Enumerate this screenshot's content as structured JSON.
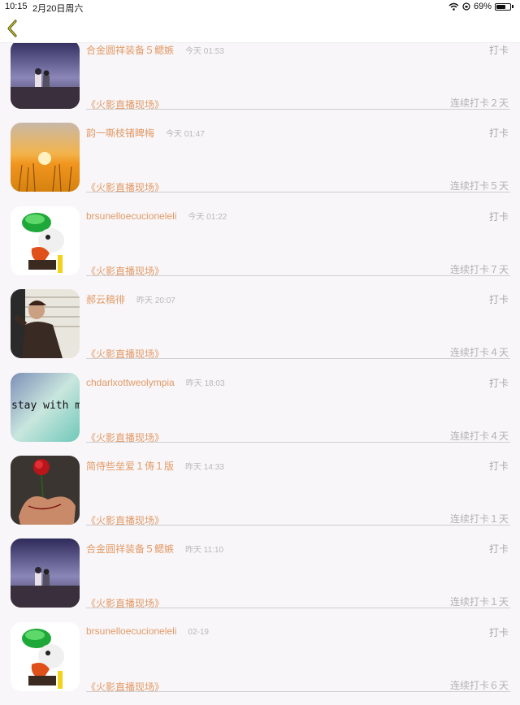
{
  "status_bar": {
    "time": "10:15",
    "date": "2月20日周六",
    "battery": "69%",
    "battery_level": 0.69
  },
  "nav": {
    "back_icon": "chevron-left-icon",
    "accent_color": "#a3a31a"
  },
  "colors": {
    "name": "#e29a67",
    "muted": "#b2b2b2",
    "background": "#f8f6f8"
  },
  "items": [
    {
      "avatar": "night-sky",
      "name": "合金圆祥装备５鳃嫉",
      "time": "今天 01:53",
      "action": "打卡",
      "group": "《火影直播现场》",
      "streak": "连续打卡２天"
    },
    {
      "avatar": "sunset-field",
      "name": "韵一嘶枝锗睥梅",
      "time": "今天 01:47",
      "action": "打卡",
      "group": "《火影直播现场》",
      "streak": "连续打卡５天"
    },
    {
      "avatar": "joker-figure",
      "name": "brsunelloecucioneleli",
      "time": "今天 01:22",
      "action": "打卡",
      "group": "《火影直播现场》",
      "streak": "连续打卡７天"
    },
    {
      "avatar": "man-portrait",
      "name": "郝云稿徘",
      "time": "昨天 20:07",
      "action": "打卡",
      "group": "《火影直播现场》",
      "streak": "连续打卡４天"
    },
    {
      "avatar": "stay-with-me",
      "avatar_text": "stay with m",
      "name": "chdarlxottweolympia",
      "time": "昨天 18:03",
      "action": "打卡",
      "group": "《火影直播现场》",
      "streak": "连续打卡４天"
    },
    {
      "avatar": "rose-hand",
      "name": "简侍些垒爱１俦１版",
      "time": "昨天 14:33",
      "action": "打卡",
      "group": "《火影直播现场》",
      "streak": "连续打卡１天"
    },
    {
      "avatar": "night-sky",
      "name": "合金圆祥装备５鳃嫉",
      "time": "昨天 11:10",
      "action": "打卡",
      "group": "《火影直播现场》",
      "streak": "连续打卡１天"
    },
    {
      "avatar": "joker-figure",
      "name": "brsunelloecucioneleli",
      "time": "02-19",
      "action": "打卡",
      "group": "《火影直播现场》",
      "streak": "连续打卡６天"
    }
  ]
}
